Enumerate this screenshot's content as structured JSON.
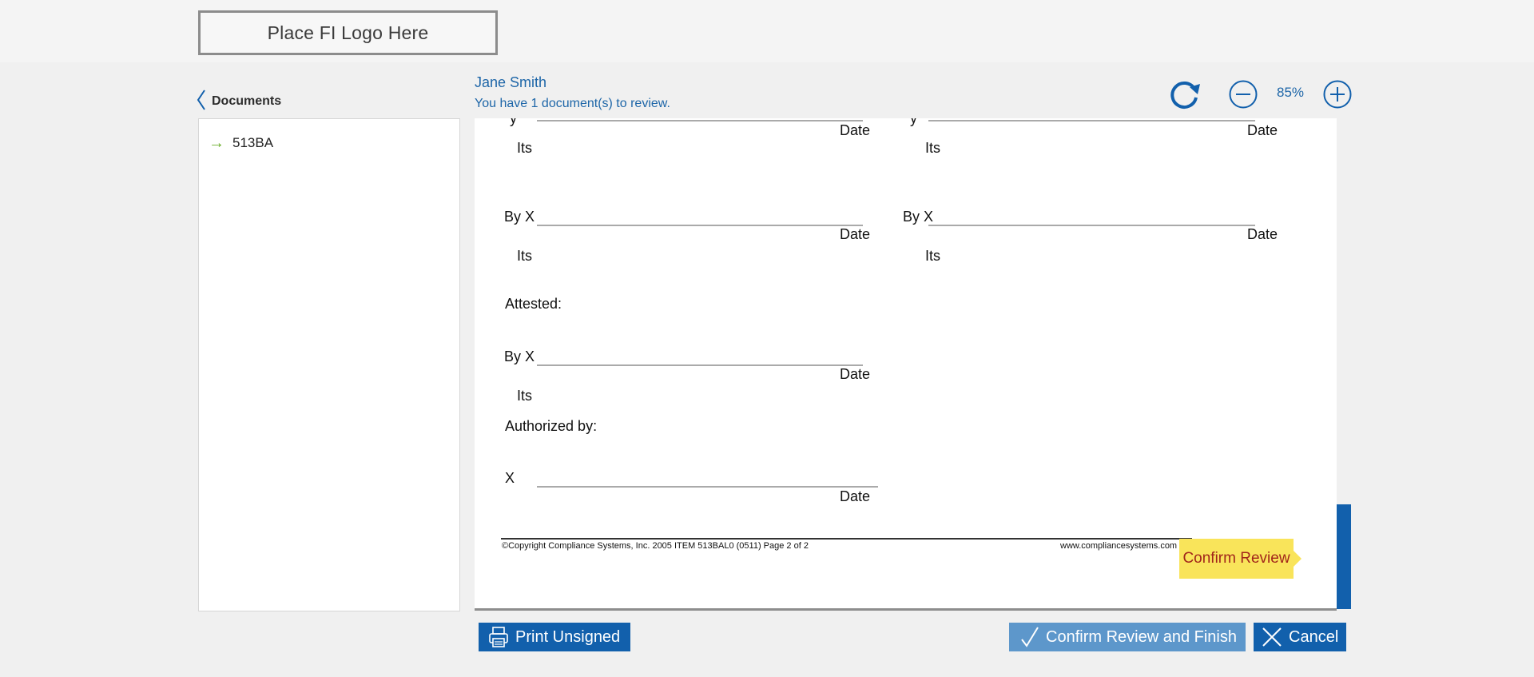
{
  "header": {
    "logo_text": "Place FI Logo Here"
  },
  "nav": {
    "back_label": "Documents"
  },
  "sidebar": {
    "items": [
      {
        "label": "513BA"
      }
    ]
  },
  "user": {
    "name": "Jane Smith",
    "message": "You have 1 document(s) to review."
  },
  "toolbar": {
    "zoom": "85%"
  },
  "document": {
    "top_partial": {
      "left_y": "y",
      "left_date": "Date",
      "left_its": "Its",
      "right_y": "y",
      "right_date": "Date",
      "right_its": "Its"
    },
    "row2": {
      "left_by": "By X",
      "left_date": "Date",
      "left_its": "Its",
      "right_by": "By X",
      "right_date": "Date",
      "right_its": "Its"
    },
    "attested_label": "Attested:",
    "row3": {
      "by": "By X",
      "date": "Date",
      "its": "Its"
    },
    "authorized_label": "Authorized by:",
    "row4": {
      "x": "X",
      "date": "Date"
    },
    "footer_left": "©Copyright Compliance Systems, Inc.  2005  ITEM 513BAL0  (0511)  Page 2 of 2",
    "footer_right": "www.compliancesystems.com"
  },
  "confirm_tag": "Confirm Review",
  "buttons": {
    "print": "Print Unsigned",
    "finish": "Confirm Review and Finish",
    "cancel": "Cancel"
  },
  "colors": {
    "accent": "#1260ac",
    "link_text": "#1e66a8",
    "highlight": "#f9e45a",
    "highlight_text": "#a2261b",
    "arrow": "#6cae2c"
  }
}
